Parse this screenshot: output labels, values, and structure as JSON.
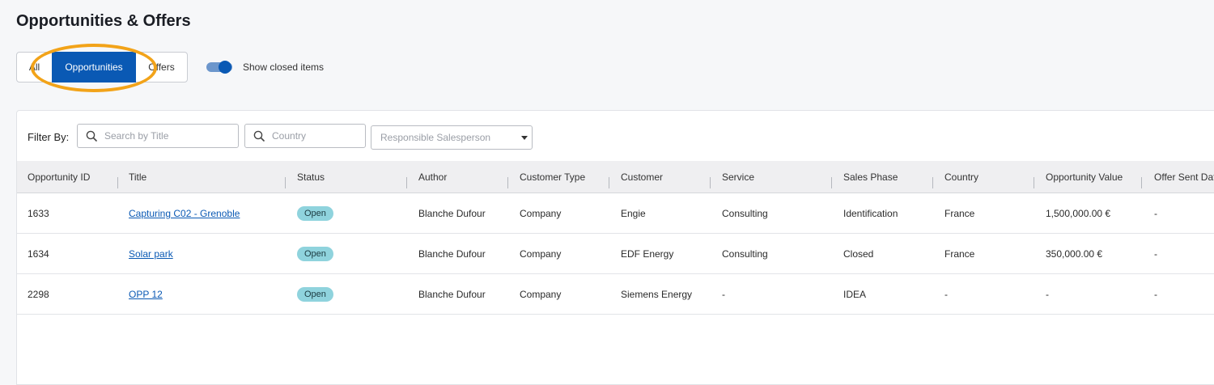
{
  "page": {
    "title": "Opportunities & Offers"
  },
  "segmented": {
    "items": [
      "All",
      "Opportunities",
      "Offers"
    ],
    "selected": "Opportunities"
  },
  "toggle": {
    "label": "Show closed items",
    "on": true
  },
  "filters": {
    "label": "Filter By:",
    "title_placeholder": "Search by Title",
    "country_placeholder": "Country",
    "salesperson_placeholder": "Responsible Salesperson"
  },
  "table": {
    "columns": [
      "Opportunity ID",
      "Title",
      "Status",
      "Author",
      "Customer Type",
      "Customer",
      "Service",
      "Sales Phase",
      "Country",
      "Opportunity Value",
      "Offer Sent Date"
    ],
    "rows": [
      {
        "id": "1633",
        "title": "Capturing C02 - Grenoble",
        "status": "Open",
        "author": "Blanche Dufour",
        "customer_type": "Company",
        "customer": "Engie",
        "service": "Consulting",
        "sales_phase": "Identification",
        "country": "France",
        "value": "1,500,000.00 €",
        "offer_sent": "-"
      },
      {
        "id": "1634",
        "title": "Solar park",
        "status": "Open",
        "author": "Blanche Dufour",
        "customer_type": "Company",
        "customer": "EDF Energy",
        "service": "Consulting",
        "sales_phase": "Closed",
        "country": "France",
        "value": "350,000.00 €",
        "offer_sent": "-"
      },
      {
        "id": "2298",
        "title": "OPP 12",
        "status": "Open",
        "author": "Blanche Dufour",
        "customer_type": "Company",
        "customer": "Siemens Energy",
        "service": "-",
        "sales_phase": "IDEA",
        "country": "-",
        "value": "-",
        "offer_sent": "-"
      }
    ]
  },
  "colors": {
    "primary": "#0a59b4",
    "highlight_ring": "#f2a319",
    "status_open_bg": "#8fd3dd"
  }
}
